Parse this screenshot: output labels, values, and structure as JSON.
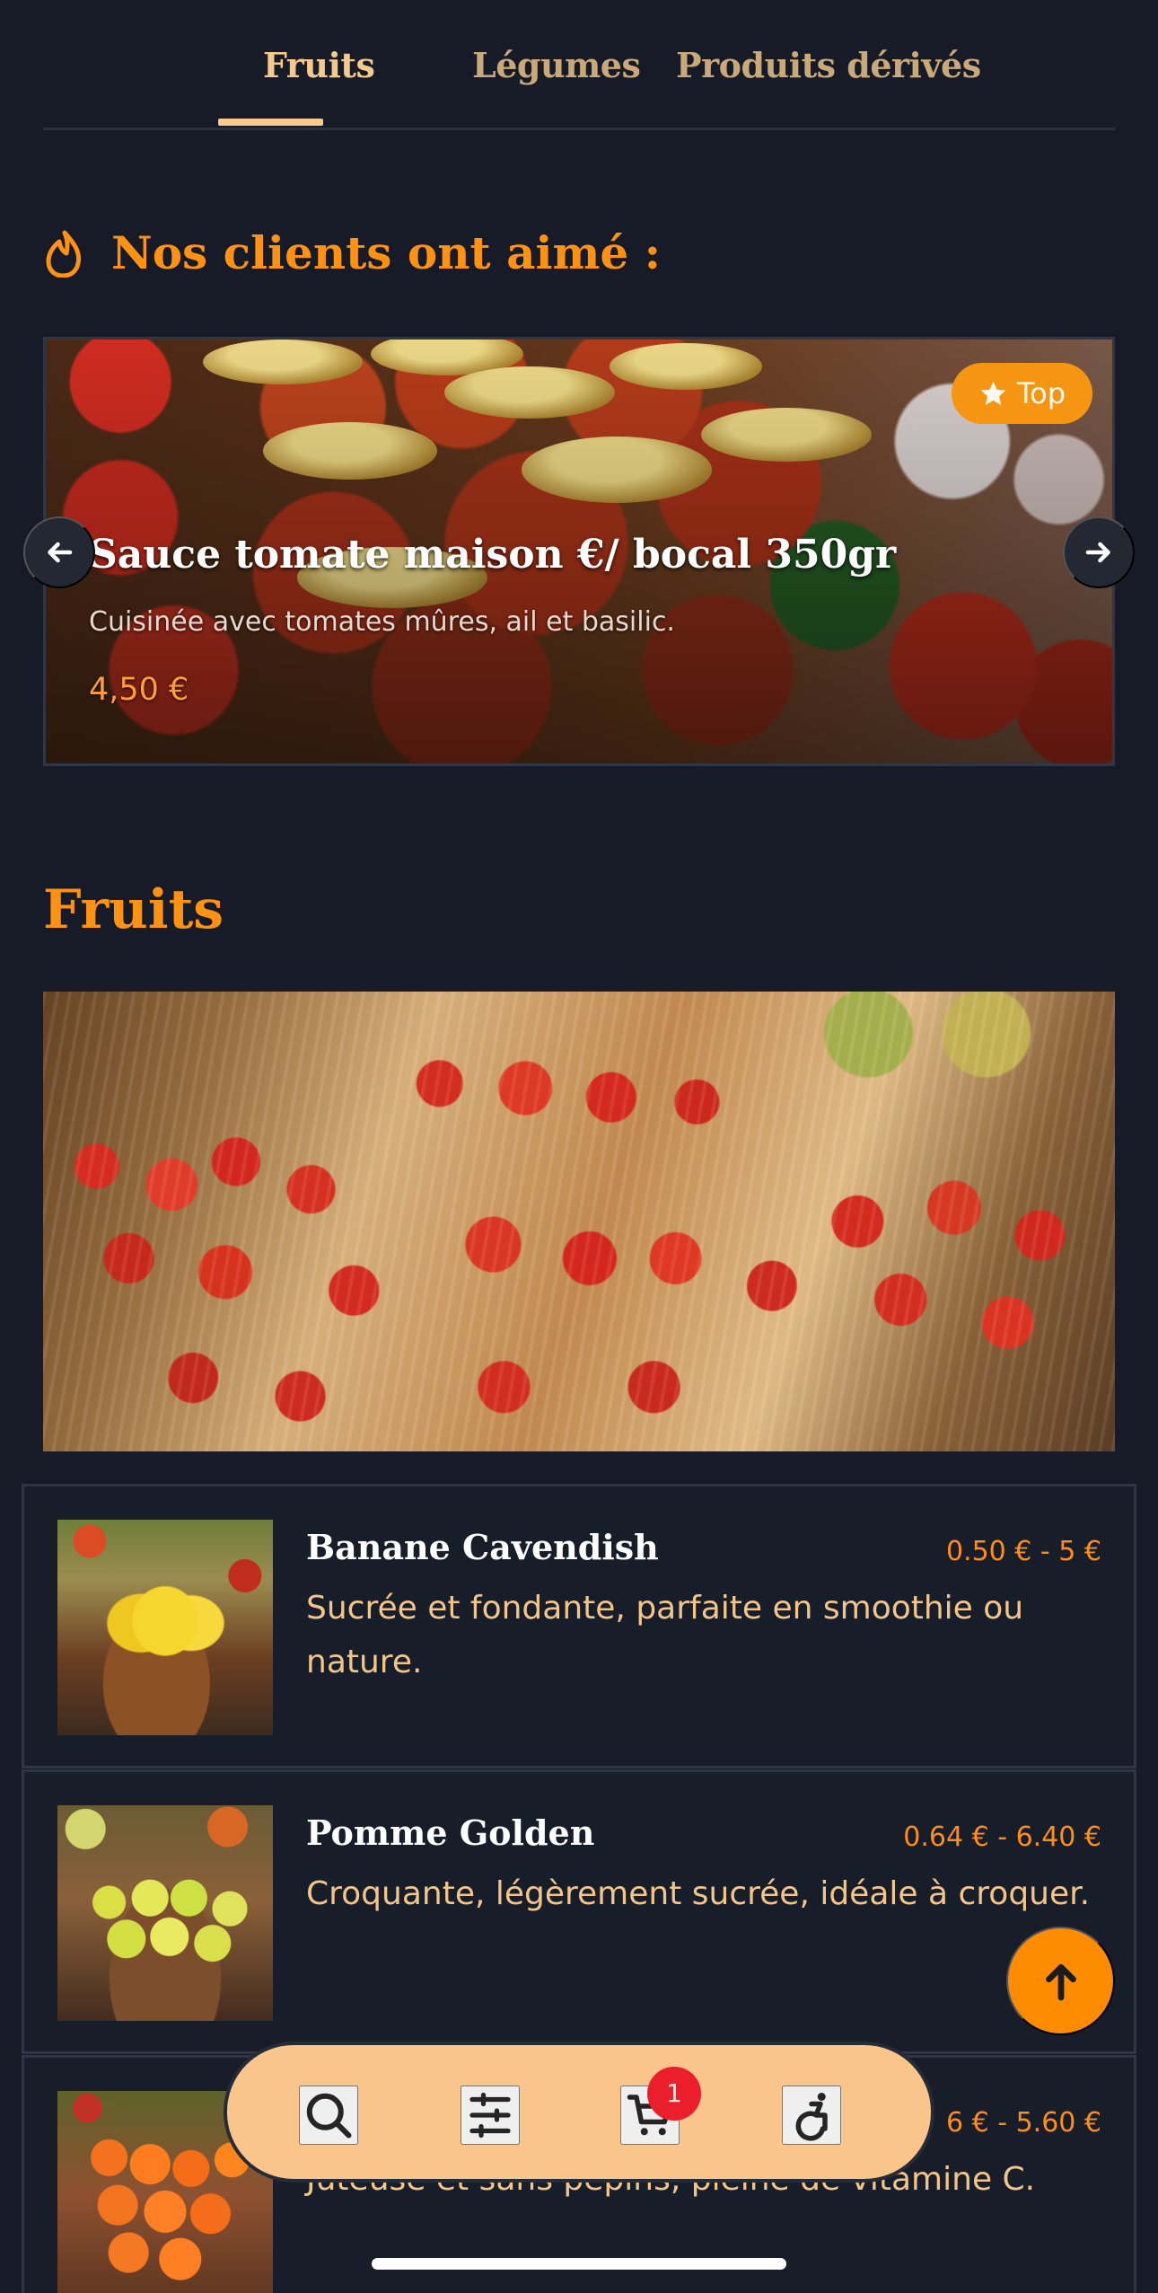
{
  "tabs": [
    {
      "label": "Fruits",
      "active": true
    },
    {
      "label": "Légumes",
      "active": false
    },
    {
      "label": "Produits dérivés",
      "active": false
    }
  ],
  "loved_section": {
    "title": "Nos clients ont aimé :",
    "icon": "flame-icon",
    "featured": {
      "badge": "Top",
      "badge_icon": "star-icon",
      "title": "Sauce tomate maison €/ bocal 350gr",
      "description": "Cuisinée avec tomates mûres, ail et basilic.",
      "price": "4,50 €"
    }
  },
  "fruits_section": {
    "title": "Fruits",
    "products": [
      {
        "name": "Banane Cavendish",
        "price_range": "0.50 € - 5 €",
        "description": "Sucrée et fondante, parfaite en smoothie ou nature."
      },
      {
        "name": "Pomme Golden",
        "price_range": "0.64 € - 6.40 €",
        "description": "Croquante, légèrement sucrée, idéale à croquer."
      },
      {
        "name": "",
        "price_range": "6 € - 5.60 €",
        "description": "Juteuse et sans pépins, pleine de vitamine C."
      }
    ]
  },
  "bottom_nav": {
    "items": [
      {
        "icon": "search-icon"
      },
      {
        "icon": "sliders-icon"
      },
      {
        "icon": "cart-icon"
      },
      {
        "icon": "accessibility-icon"
      }
    ],
    "cart_count": "1"
  },
  "colors": {
    "background": "#161b27",
    "accent": "#ff8b00",
    "nav_bar": "#fac58a",
    "tab_active": "#f7c98a"
  }
}
